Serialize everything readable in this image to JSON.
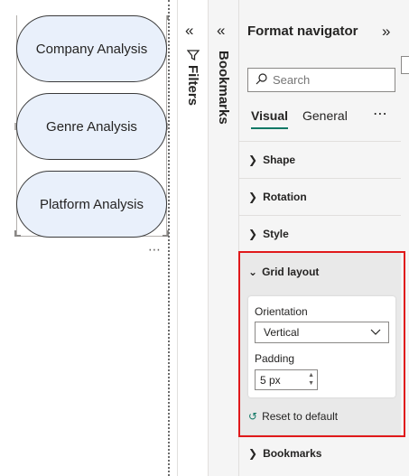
{
  "canvas": {
    "buttons": [
      {
        "label": "Company Analysis"
      },
      {
        "label": "Genre Analysis"
      },
      {
        "label": "Platform Analysis"
      }
    ],
    "more_label": "⋯"
  },
  "filters_pane": {
    "label": "Filters",
    "icon": "filter-icon",
    "expand_glyph": "«"
  },
  "bookmarks_pane": {
    "label": "Bookmarks",
    "expand_glyph": "«"
  },
  "format_pane": {
    "title": "Format navigator",
    "collapse_glyph": "»",
    "search": {
      "placeholder": "Search"
    },
    "tabs": [
      {
        "label": "Visual",
        "active": true
      },
      {
        "label": "General",
        "active": false
      }
    ],
    "tabs_more": "⋯",
    "sections": [
      {
        "label": "Shape"
      },
      {
        "label": "Rotation"
      },
      {
        "label": "Style"
      }
    ],
    "grid_layout": {
      "label": "Grid layout",
      "orientation_label": "Orientation",
      "orientation_value": "Vertical",
      "padding_label": "Padding",
      "padding_value": "5 px",
      "reset_label": "Reset to default"
    },
    "bookmarks_section": {
      "label": "Bookmarks"
    }
  },
  "colors": {
    "accent": "#117865",
    "highlight": "#e0191b",
    "button_fill": "#e9f0fb"
  }
}
